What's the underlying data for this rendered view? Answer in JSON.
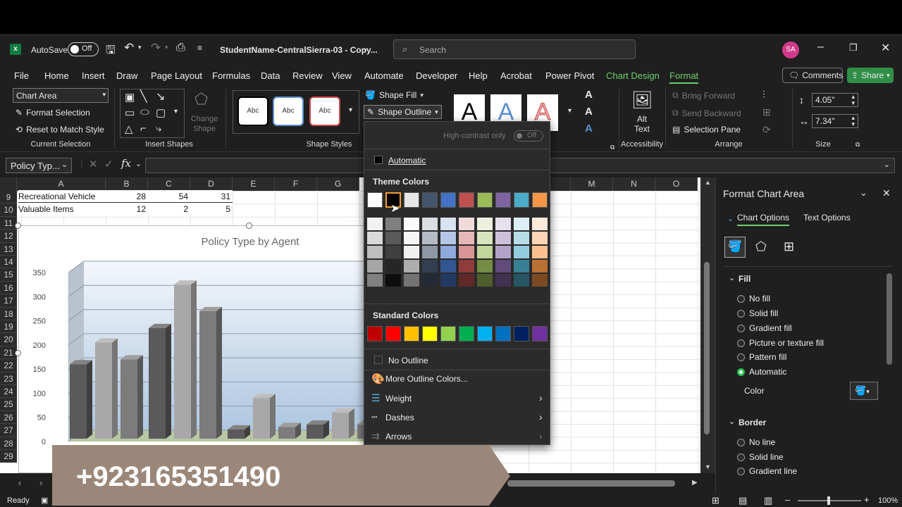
{
  "titlebar": {
    "autosave": "AutoSave",
    "autosave_state": "Off",
    "filename": "StudentName-CentralSierra-03 - Copy...",
    "search_placeholder": "Search",
    "avatar": "SA"
  },
  "menu": [
    "File",
    "Home",
    "Insert",
    "Draw",
    "Page Layout",
    "Formulas",
    "Data",
    "Review",
    "View",
    "Automate",
    "Developer",
    "Help",
    "Acrobat",
    "Power Pivot",
    "Chart Design",
    "Format"
  ],
  "menu_right": {
    "comments": "Comments",
    "share": "Share"
  },
  "ribbon": {
    "selection_box": "Chart Area",
    "format_selection": "Format Selection",
    "reset_style": "Reset to Match Style",
    "current_selection": "Current Selection",
    "change_shape": "Change Shape",
    "insert_shapes": "Insert Shapes",
    "style_sample": "Abc",
    "shape_fill": "Shape Fill",
    "shape_outline": "Shape Outline",
    "shape_styles": "Shape Styles",
    "wordart_letter": "A",
    "alt_text": "Alt Text",
    "accessibility": "Accessibility",
    "bring_forward": "Bring Forward",
    "send_backward": "Send Backward",
    "selection_pane": "Selection Pane",
    "arrange": "Arrange",
    "height": "4.05\"",
    "width": "7.34\"",
    "size": "Size"
  },
  "namebox": "Policy Typ...",
  "columns": [
    "A",
    "B",
    "C",
    "D",
    "E",
    "F",
    "G",
    "M",
    "N",
    "O"
  ],
  "rows": [
    "9",
    "10",
    "11",
    "12",
    "13",
    "14",
    "15",
    "16",
    "17",
    "18",
    "19",
    "20",
    "21",
    "22",
    "23",
    "24",
    "25",
    "26",
    "27",
    "28",
    "29"
  ],
  "table": [
    {
      "label": "Recreational Vehicle",
      "b": "28",
      "c": "54",
      "d": "31"
    },
    {
      "label": "Valuable Items",
      "b": "12",
      "c": "2",
      "d": "5"
    }
  ],
  "chart_data": {
    "type": "bar",
    "title": "Policy Type by Agent",
    "y_ticks": [
      "350",
      "300",
      "250",
      "200",
      "150",
      "100",
      "50",
      "0"
    ],
    "ylim": [
      0,
      350
    ],
    "series": [
      {
        "values": [
          160,
          235,
          25,
          35
        ]
      },
      {
        "values": [
          205,
          325,
          90,
          60
        ]
      },
      {
        "values": [
          170,
          270,
          30,
          35
        ]
      }
    ],
    "colors": [
      "#5a5a5a",
      "#a8a8a8",
      "#7c7c7c"
    ]
  },
  "outline_menu": {
    "high_contrast": "High-contrast only",
    "toggle": "Off",
    "automatic": "Automatic",
    "theme_colors": "Theme Colors",
    "standard_colors": "Standard Colors",
    "no_outline": "No Outline",
    "more_colors": "More Outline Colors...",
    "weight": "Weight",
    "dashes": "Dashes",
    "arrows": "Arrows",
    "theme": [
      "#ffffff",
      "#000000",
      "#e7e6e6",
      "#44546a",
      "#4472c4",
      "#c0504d",
      "#9bbb59",
      "#8064a2",
      "#4bacc6",
      "#f79646"
    ],
    "standard": [
      "#c00000",
      "#ff0000",
      "#ffc000",
      "#ffff00",
      "#92d050",
      "#00b050",
      "#00b0f0",
      "#0070c0",
      "#002060",
      "#7030a0"
    ]
  },
  "pane": {
    "title": "Format Chart Area",
    "tab_chart": "Chart Options",
    "tab_text": "Text Options",
    "fill": "Fill",
    "fill_options": [
      "No fill",
      "Solid fill",
      "Gradient fill",
      "Picture or texture fill",
      "Pattern fill",
      "Automatic"
    ],
    "color": "Color",
    "border": "Border",
    "border_options": [
      "No line",
      "Solid line",
      "Gradient line"
    ]
  },
  "status": {
    "ready": "Ready",
    "zoom": "100%"
  },
  "banner": {
    "phone": "+923165351490"
  }
}
